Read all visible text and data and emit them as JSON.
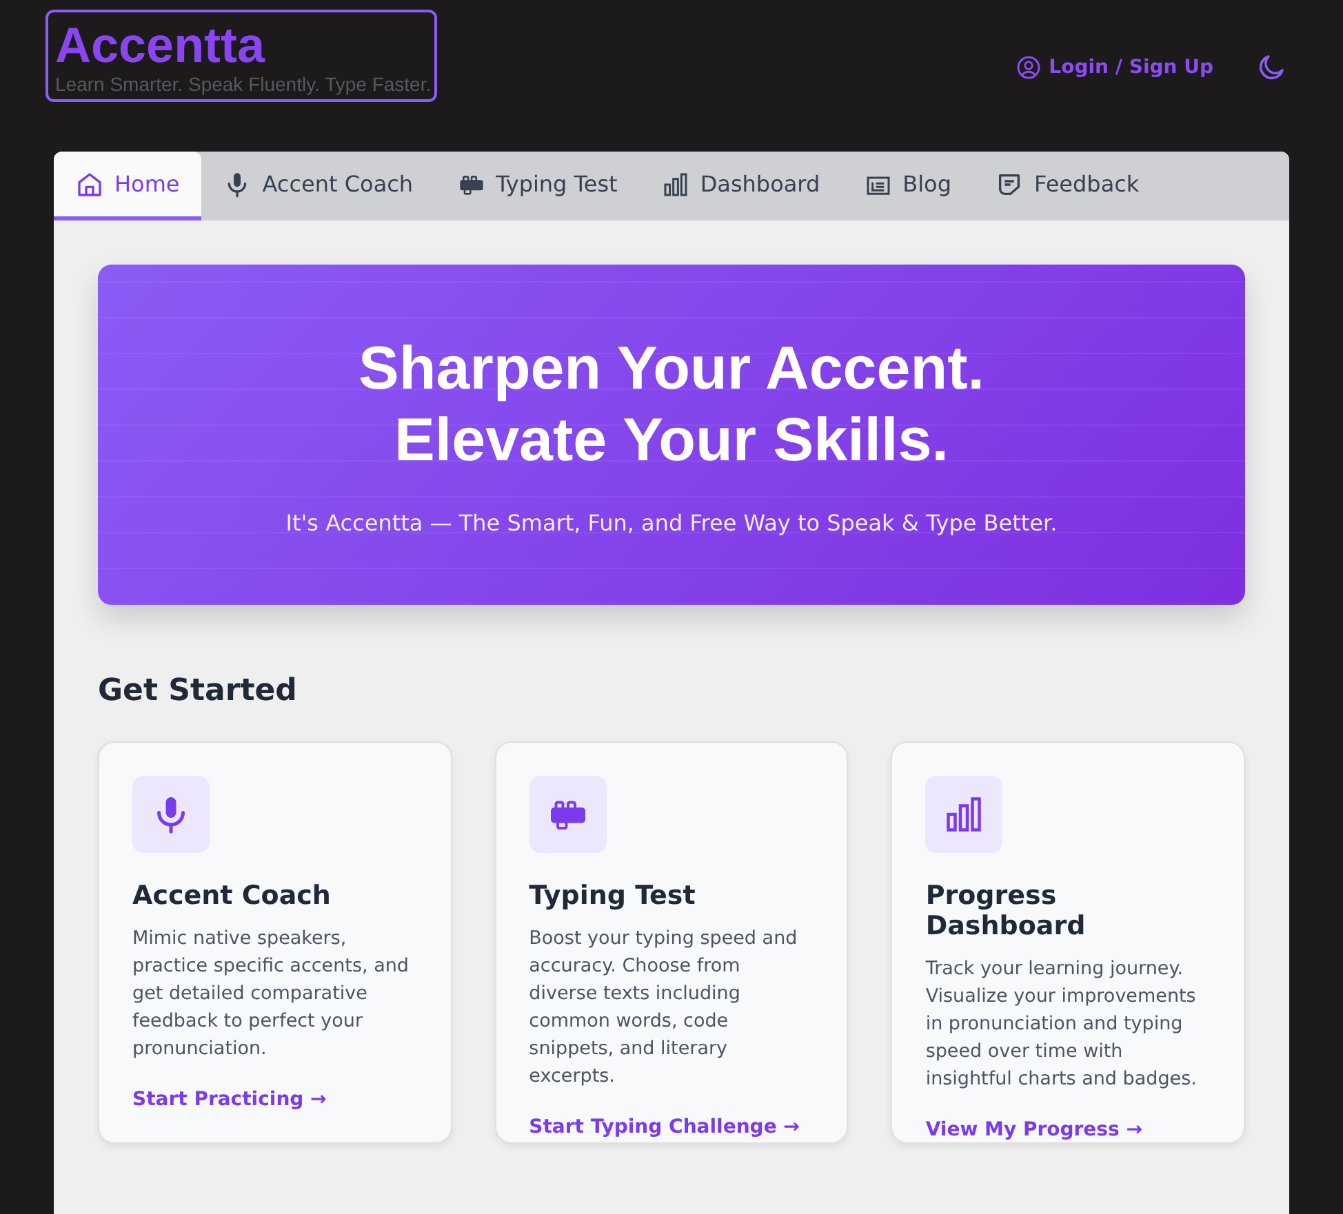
{
  "brand": {
    "name": "Accentta",
    "tagline": "Learn Smarter. Speak Fluently. Type Faster."
  },
  "header": {
    "login": "Login / Sign Up"
  },
  "tabs": [
    {
      "label": "Home",
      "kind": "home",
      "selected": true
    },
    {
      "label": "Accent Coach",
      "kind": "mic",
      "selected": false
    },
    {
      "label": "Typing Test",
      "kind": "keyboard",
      "selected": false
    },
    {
      "label": "Dashboard",
      "kind": "chart",
      "selected": false
    },
    {
      "label": "Blog",
      "kind": "blog",
      "selected": false
    },
    {
      "label": "Feedback",
      "kind": "feedback",
      "selected": false
    }
  ],
  "hero": {
    "title_lines": [
      "Sharpen Your Accent.",
      "Elevate Your Skills."
    ],
    "subtitle": "It's Accentta — The Smart, Fun, and Free Way to Speak & Type Better."
  },
  "section_title": "Get Started",
  "cards": [
    {
      "kind": "mic",
      "title": "Accent Coach",
      "text": "Mimic native speakers, practice specific accents, and get detailed comparative feedback to perfect your pronunciation.",
      "link": "Start Practicing →"
    },
    {
      "kind": "keyboard",
      "title": "Typing Test",
      "text": "Boost your typing speed and accuracy. Choose from diverse texts including common words, code snippets, and literary excerpts.",
      "link": "Start Typing Challenge →"
    },
    {
      "kind": "chart",
      "title": "Progress Dashboard",
      "text": "Track your learning journey. Visualize your improvements in pronunciation and typing speed over time with insightful charts and badges.",
      "link": "View My Progress →"
    }
  ]
}
